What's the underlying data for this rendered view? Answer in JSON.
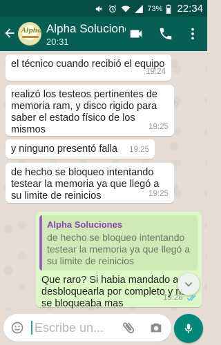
{
  "status_bar": {
    "battery": "73%",
    "time": "22:34"
  },
  "header": {
    "contact_name": "Alpha Soluciones",
    "contact_status": "20:31",
    "avatar_logo_text": "Alpha"
  },
  "messages": [
    {
      "direction": "in",
      "text": "el técnico cuando recibió el equipo",
      "time": "19:24"
    },
    {
      "direction": "in",
      "text": "realizó los testeos pertinentes de memoria ram, y disco rigido para saber el estado físico de los mismos",
      "time": "19:25"
    },
    {
      "direction": "in",
      "text": "y ninguno presentó falla",
      "time": "19:25"
    },
    {
      "direction": "in",
      "text": "de hecho se bloqueo intentando testear la memoria ya que llegó a su limite de reinicios",
      "time": "19:25"
    },
    {
      "direction": "out",
      "quote_author": "Alpha Soluciones",
      "quote_text": "de hecho se bloqueo intentando testear la memoria ya que llegó a su limite de reinicios",
      "text": "Que raro? Si habia mandado a desbloquearla por completo y no se bloqueaba mas",
      "time": "19:26"
    }
  ],
  "composer": {
    "placeholder": "Escribe un..."
  },
  "colors": {
    "appbar": "#075e54",
    "statusbar": "#054d44",
    "chat_bg": "#e5ddd5",
    "bubble_in": "#ffffff",
    "bubble_out": "#dcf8c6",
    "quote_author": "#8e44ad",
    "read_ticks": "#4fc3f7",
    "mic_button": "#00897b"
  },
  "icons": [
    "mute-icon",
    "alarm-icon",
    "wifi-icon",
    "signal-icon",
    "battery-icon",
    "back-arrow-icon",
    "video-call-icon",
    "phone-icon",
    "more-vert-icon",
    "emoji-icon",
    "attach-icon",
    "camera-icon",
    "mic-icon",
    "chevron-down-icon",
    "double-check-icon"
  ]
}
